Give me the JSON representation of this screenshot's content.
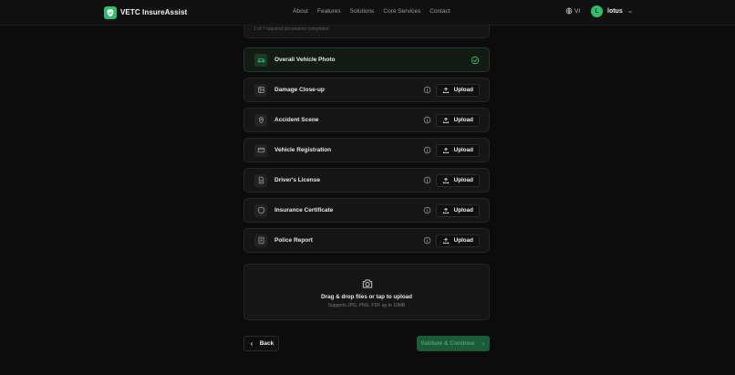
{
  "header": {
    "brand_name": "VETC InsureAssist",
    "nav": [
      "About",
      "Features",
      "Solutions",
      "Core Services",
      "Contact"
    ],
    "language": "VI",
    "user_initial": "L",
    "user_name": "lotus"
  },
  "progress_text": "1 of 7 required documents completed",
  "documents": [
    {
      "label": "Overall Vehicle Photo",
      "status": "completed",
      "icon": "car-icon"
    },
    {
      "label": "Damage Close-up",
      "status": "pending",
      "icon": "image-icon",
      "upload_label": "Upload"
    },
    {
      "label": "Accident Scene",
      "status": "pending",
      "icon": "map-pin-icon",
      "upload_label": "Upload"
    },
    {
      "label": "Vehicle Registration",
      "status": "pending",
      "icon": "card-icon",
      "upload_label": "Upload"
    },
    {
      "label": "Driver's License",
      "status": "pending",
      "icon": "file-icon",
      "upload_label": "Upload"
    },
    {
      "label": "Insurance Certificate",
      "status": "pending",
      "icon": "shield-icon",
      "upload_label": "Upload"
    },
    {
      "label": "Police Report",
      "status": "pending",
      "icon": "report-icon",
      "upload_label": "Upload"
    }
  ],
  "dropzone": {
    "title": "Drag & drop files or tap to upload",
    "subtitle": "Supports JPG, PNG, PDF up to 10MB"
  },
  "footer": {
    "back_label": "Back",
    "continue_label": "Validate & Continue"
  },
  "colors": {
    "accent": "#2fbf6a",
    "background": "#0c0c0c",
    "card": "#161616",
    "continue_disabled": "#1a5c35"
  }
}
